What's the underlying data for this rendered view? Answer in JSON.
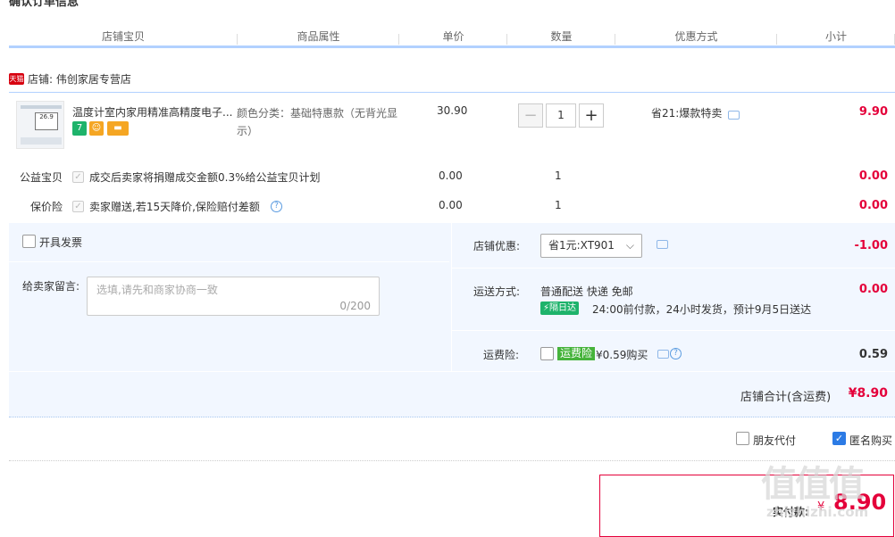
{
  "page": {
    "title": "确认订单信息"
  },
  "columns": [
    "店铺宝贝",
    "商品属性",
    "单价",
    "数量",
    "优惠方式",
    "小计"
  ],
  "shop": {
    "badge": "天猫",
    "label": "店铺: 伟创家居专营店"
  },
  "product": {
    "title": "温度计室内家用精准高精度电子...",
    "thumb_text": "26.9",
    "badges": [
      "7",
      "☺",
      "▬"
    ],
    "attr": "颜色分类：基础特惠款（无背光显示）",
    "price": "30.90",
    "qty_minus": "−",
    "qty": "1",
    "qty_plus": "+",
    "promo": "省21:爆款特卖",
    "subtotal": "9.90"
  },
  "charity": {
    "label": "公益宝贝",
    "text": "成交后卖家将捐赠成交金额0.3%给公益宝贝计划",
    "price": "0.00",
    "qty": "1",
    "amount": "0.00"
  },
  "insurance": {
    "label": "保价险",
    "text": "卖家赠送,若15天降价,保险赔付差额",
    "help": "?",
    "price": "0.00",
    "qty": "1",
    "amount": "0.00"
  },
  "invoice": {
    "label": "开具发票"
  },
  "message": {
    "label": "给卖家留言:",
    "placeholder": "选填,请先和商家协商一致",
    "counter": "0/200"
  },
  "coupon": {
    "label": "店铺优惠:",
    "selected": "省1元:XT901",
    "chevron": "⌵",
    "amount": "-1.00"
  },
  "shipping": {
    "label": "运送方式:",
    "method": "普通配送 快递 免邮",
    "badge_icon": "⚡",
    "badge": "隔日达",
    "desc": "24:00前付款，24小时发货，预计9月5日送达",
    "amount": "0.00"
  },
  "freight": {
    "label": "运费险:",
    "badge": "运费险",
    "price": "¥0.59购买",
    "help": "?",
    "amount": "0.59"
  },
  "shop_total": {
    "label": "店铺合计(含运费)",
    "amount": "¥8.90"
  },
  "options": {
    "friend_pay": "朋友代付",
    "anon_buy": "匿名购买",
    "anon_check": "✓"
  },
  "payment": {
    "label": "实付款:",
    "currency": "¥",
    "amount": "8.90"
  },
  "watermark": {
    "title": "值值值",
    "url": "zhizhizhi.com"
  },
  "colors": {
    "accent_red": "#e4003a",
    "line_blue": "#b2d1ff",
    "panel_bg": "#f2f7ff"
  }
}
